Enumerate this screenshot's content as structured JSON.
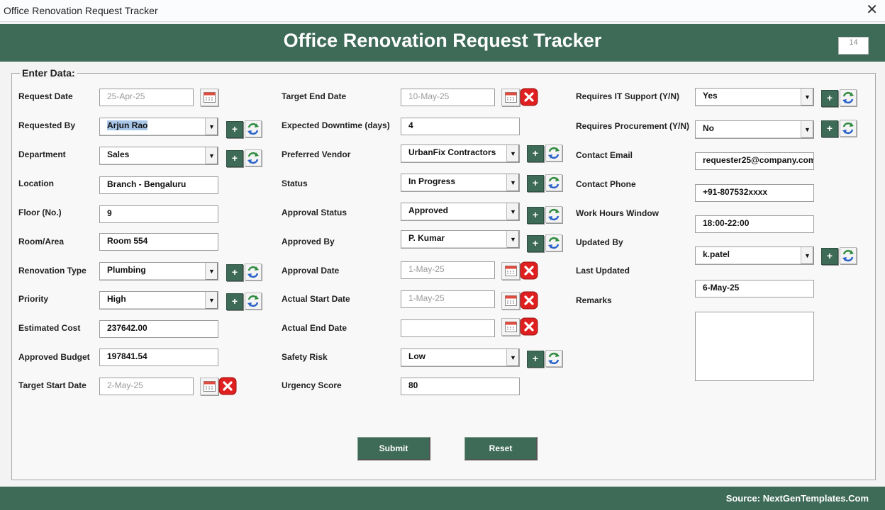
{
  "window": {
    "title": "Office Renovation Request Tracker",
    "close_glyph": "✕"
  },
  "header": {
    "title": "Office Renovation Request Tracker",
    "record_counter": "14"
  },
  "section": {
    "legend": "Enter Data:"
  },
  "col1": {
    "request_date": {
      "label": "Request Date",
      "value": "25-Apr-25"
    },
    "requested_by": {
      "label": "Requested By",
      "value": "Arjun Rao"
    },
    "department": {
      "label": "Department",
      "value": "Sales"
    },
    "location": {
      "label": "Location",
      "value": "Branch - Bengaluru"
    },
    "floor": {
      "label": "Floor (No.)",
      "value": "9"
    },
    "room_area": {
      "label": "Room/Area",
      "value": "Room 554"
    },
    "renovation_type": {
      "label": "Renovation Type",
      "value": "Plumbing"
    },
    "priority": {
      "label": "Priority",
      "value": "High"
    },
    "estimated_cost": {
      "label": "Estimated Cost",
      "value": "237642.00"
    },
    "approved_budget": {
      "label": "Approved Budget",
      "value": "197841.54"
    },
    "target_start_date": {
      "label": "Target Start Date",
      "value": "2-May-25"
    }
  },
  "col2": {
    "target_end_date": {
      "label": "Target End Date",
      "value": "10-May-25"
    },
    "expected_downtime": {
      "label": "Expected Downtime (days)",
      "value": "4"
    },
    "preferred_vendor": {
      "label": "Preferred Vendor",
      "value": "UrbanFix Contractors"
    },
    "status": {
      "label": "Status",
      "value": "In Progress"
    },
    "approval_status": {
      "label": "Approval Status",
      "value": "Approved"
    },
    "approved_by": {
      "label": "Approved By",
      "value": "P. Kumar"
    },
    "approval_date": {
      "label": "Approval Date",
      "value": "1-May-25"
    },
    "actual_start_date": {
      "label": "Actual Start Date",
      "value": "1-May-25"
    },
    "actual_end_date": {
      "label": "Actual End Date",
      "value": ""
    },
    "safety_risk": {
      "label": "Safety Risk",
      "value": "Low"
    },
    "urgency_score": {
      "label": "Urgency Score",
      "value": "80"
    }
  },
  "col3": {
    "requires_it_support": {
      "label": "Requires IT Support (Y/N)",
      "value": "Yes"
    },
    "requires_procurement": {
      "label": "Requires Procurement (Y/N)",
      "value": "No"
    },
    "contact_email": {
      "label": "Contact Email",
      "value": "requester25@company.com"
    },
    "contact_phone": {
      "label": "Contact Phone",
      "value": "+91-807532xxxx"
    },
    "work_hours_window": {
      "label": "Work Hours Window",
      "value": "18:00-22:00"
    },
    "updated_by": {
      "label": "Updated By",
      "value": "k.patel"
    },
    "last_updated": {
      "label": "Last Updated",
      "value": "6-May-25"
    },
    "remarks": {
      "label": "Remarks",
      "value": ""
    }
  },
  "icons": {
    "add": "+",
    "dropdown": "▼",
    "calendar": "calendar-icon",
    "refresh": "refresh-icon",
    "clear": "clear-x-icon"
  },
  "actions": {
    "submit_label": "Submit",
    "reset_label": "Reset"
  },
  "footer": {
    "source": "Source: NextGenTemplates.Com"
  },
  "colors": {
    "theme_green": "#3e6a58",
    "clear_red": "#e02020",
    "highlight": "#a8c6e8"
  }
}
